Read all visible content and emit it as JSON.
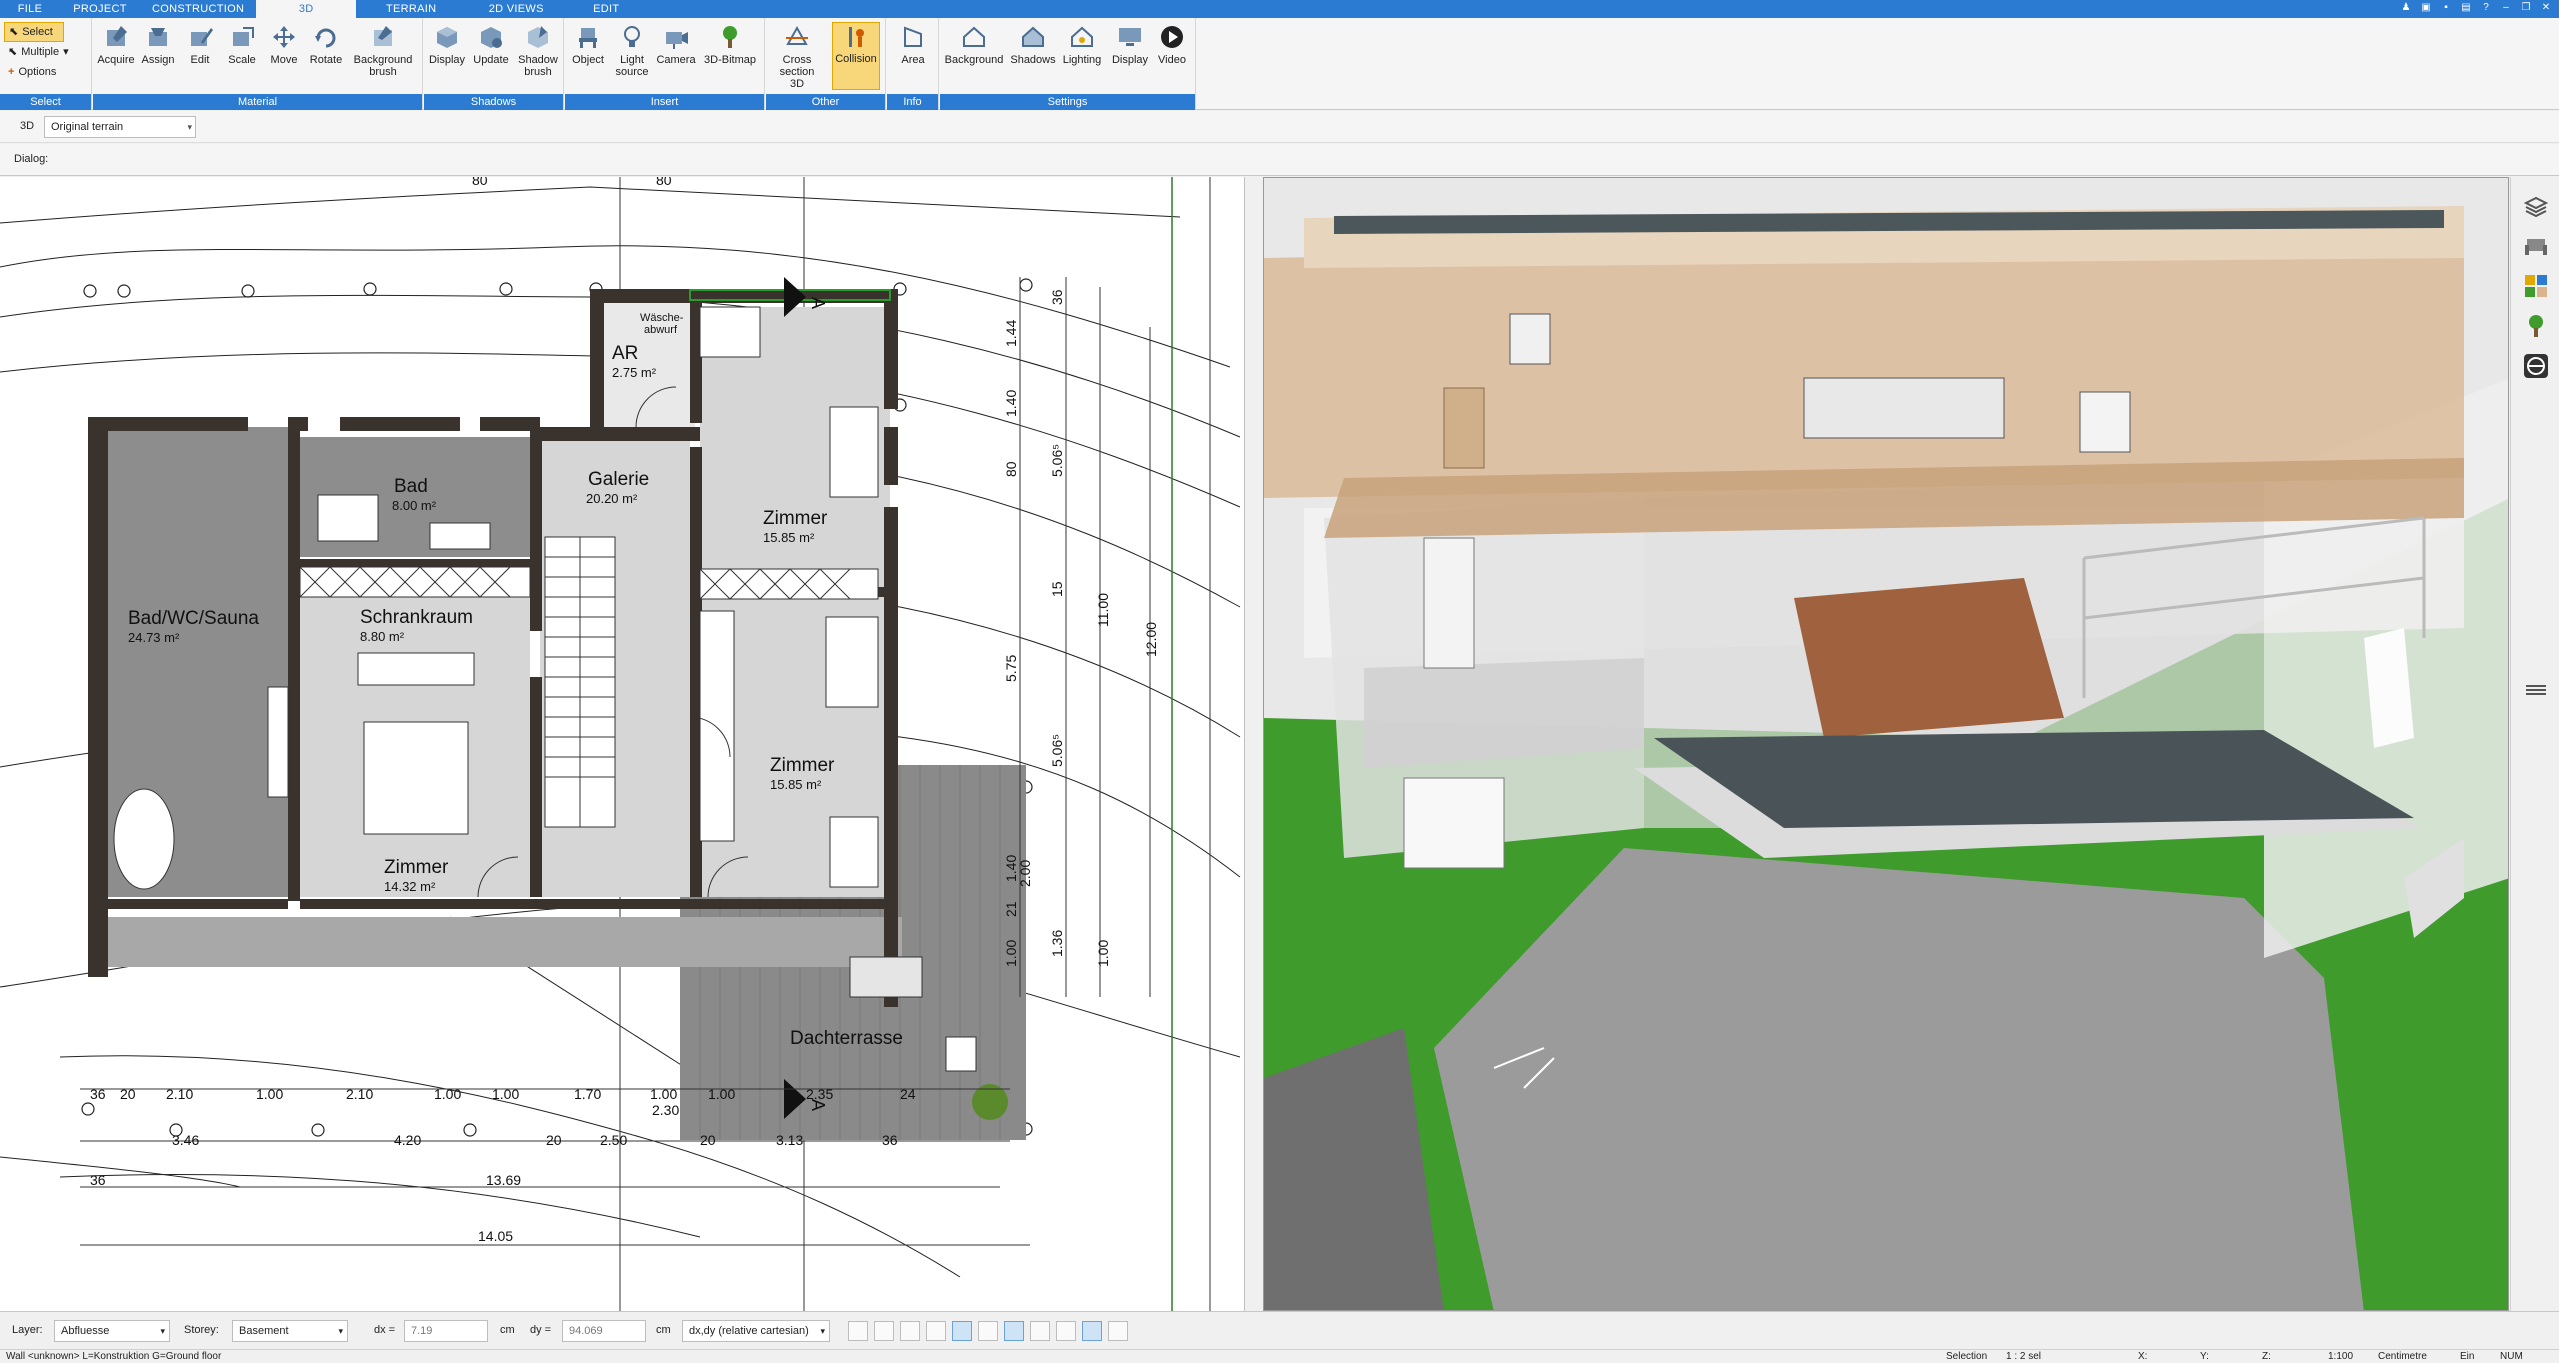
{
  "menu": {
    "tabs": [
      "FILE",
      "PROJECT",
      "CONSTRUCTION",
      "3D",
      "TERRAIN",
      "2D VIEWS",
      "EDIT"
    ],
    "active": "3D"
  },
  "ribbon": {
    "select_group": {
      "label": "Select",
      "items": [
        "Select",
        "Multiple",
        "Options"
      ]
    },
    "material_group": {
      "label": "Material",
      "buttons": [
        "Acquire",
        "Assign",
        "Edit",
        "Scale",
        "Move",
        "Rotate",
        "Background brush"
      ]
    },
    "shadows_group": {
      "label": "Shadows",
      "buttons": [
        "Display",
        "Update",
        "Shadow brush"
      ]
    },
    "insert_group": {
      "label": "Insert",
      "buttons": [
        "Object",
        "Light source",
        "Camera",
        "3D-Bitmap"
      ]
    },
    "other_group": {
      "label": "Other",
      "buttons": [
        "Cross section 3D",
        "Collision"
      ]
    },
    "info_group": {
      "label": "Info",
      "buttons": [
        "Area"
      ]
    },
    "settings_group": {
      "label": "Settings",
      "buttons": [
        "Background",
        "Shadows",
        "Lighting",
        "Display",
        "Video"
      ]
    }
  },
  "row3d": {
    "label": "3D",
    "terrain": "Original terrain"
  },
  "dialog": {
    "label": "Dialog:"
  },
  "plan": {
    "rooms": [
      {
        "name": "AR",
        "area": "2.75 m²"
      },
      {
        "name": "Bad",
        "area": "8.00 m²"
      },
      {
        "name": "Galerie",
        "area": "20.20 m²"
      },
      {
        "name": "Zimmer",
        "area": "15.85 m²"
      },
      {
        "name": "Bad/WC/Sauna",
        "area": "24.73 m²"
      },
      {
        "name": "Schrankraum",
        "area": "8.80 m²"
      },
      {
        "name": "Zimmer",
        "area": "15.85 m²"
      },
      {
        "name": "Zimmer",
        "area": "14.32 m²"
      },
      {
        "name": "Dachterrasse",
        "area": ""
      }
    ],
    "waesche": [
      "Wäsche-",
      "abwurf"
    ],
    "section_marker": "A",
    "dims_top": [
      "80",
      "80"
    ],
    "dims_right_a": [
      "36",
      "1.44",
      "1.40",
      "80",
      "15",
      "5.75",
      "2.00",
      "1.40",
      "21",
      "1.36",
      "1.00"
    ],
    "dims_right_b": [
      "5.06⁵",
      "5.06⁵",
      "11.00",
      "1.00",
      "12.00"
    ],
    "dims_bottom_1": [
      "36",
      "20",
      "2.10",
      "1.00",
      "2.10",
      "1.00",
      "1.00",
      "1.70",
      "1.00",
      "1.00",
      "2.35",
      "24"
    ],
    "dims_bottom_2": [
      "3.46",
      "4.20",
      "20",
      "2.50",
      "2.30",
      "20",
      "3.13",
      "36"
    ],
    "dims_bottom_3": [
      "36",
      "13.69"
    ],
    "dims_bottom_4": [
      "14.05"
    ]
  },
  "bottombar": {
    "layer_label": "Layer:",
    "layer_value": "Abfluesse",
    "storey_label": "Storey:",
    "storey_value": "Basement",
    "dx_label": "dx =",
    "dx_value": "7.19",
    "dx_unit": "cm",
    "dy_label": "dy =",
    "dy_value": "94.069",
    "dy_unit": "cm",
    "mode": "dx,dy (relative cartesian)"
  },
  "statusbar": {
    "left": "Wall <unknown> L=Konstruktion G=Ground floor",
    "selection": "Selection",
    "sel_value": "1 : 2 sel",
    "x": "X:",
    "y": "Y:",
    "z": "Z:",
    "scale": "1:100",
    "unit": "Centimetre",
    "mode": "Ein",
    "num": "NUM"
  },
  "colors": {
    "accent": "#2b7bd3",
    "active": "#f8d77a",
    "grass": "#3f9b2c",
    "wood": "#d9b48f"
  }
}
